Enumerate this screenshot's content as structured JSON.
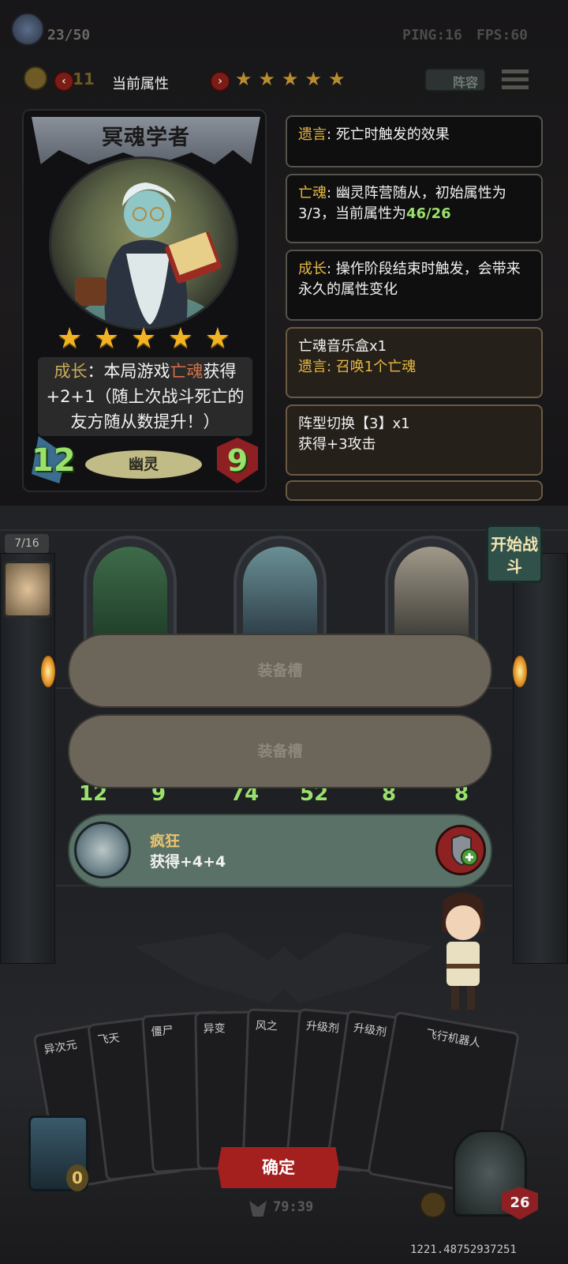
{
  "hud": {
    "capacity": "23/50",
    "ping": "PING:16",
    "fps": "FPS:60",
    "gold_suffix": "11",
    "lineup_label": "阵容"
  },
  "attr_panel": {
    "title": "当前属性",
    "star_count": 5
  },
  "card": {
    "name": "冥魂学者",
    "stars": 5,
    "desc_parts": {
      "p1": "成长",
      "p2": "：本局游戏",
      "p3": "亡魂",
      "p4": "获得+2+1（随上次战斗死亡的友方随从数提升！）"
    },
    "attack": "12",
    "health": "9",
    "tribe": "幽灵"
  },
  "tooltips": [
    {
      "key": "遗言",
      "text": ": 死亡时触发的效果"
    },
    {
      "key": "亡魂",
      "text": ": 幽灵阵营随从，初始属性为3/3，当前属性为",
      "num": "46/26"
    },
    {
      "key": "成长",
      "text": ": 操作阶段结束时触发，会带来永久的属性变化"
    },
    {
      "title": "亡魂音乐盒x1",
      "key": "遗言",
      "text": ": 召唤1个亡魂"
    },
    {
      "title": "阵型切换【3】x1",
      "text": "获得+3攻击"
    }
  ],
  "board": {
    "round": "7/16",
    "start_button": "开始战斗",
    "minion_stats": [
      {
        "atk": "12",
        "hp": "9"
      },
      {
        "atk": "74",
        "hp": "52"
      },
      {
        "atk": "8",
        "hp": "8"
      }
    ]
  },
  "slots": {
    "slot1": "装备槽",
    "slot2": "装备槽"
  },
  "equipment": {
    "name": "疯狂",
    "desc": "获得+4+4"
  },
  "hand": {
    "cards": [
      "异次元",
      "飞天",
      "僵尸",
      "异变",
      "风之",
      "升级剂",
      "升级剂",
      "飞行机器人"
    ],
    "confirm": "确定",
    "timer": "79:39",
    "deck_count": "0",
    "hero_hp": "26"
  },
  "debug_value": "1221.48752937251",
  "colors": {
    "accent_gold": "#e8b940",
    "stat_green": "#9ae16b",
    "confirm_red": "#a3201f"
  }
}
